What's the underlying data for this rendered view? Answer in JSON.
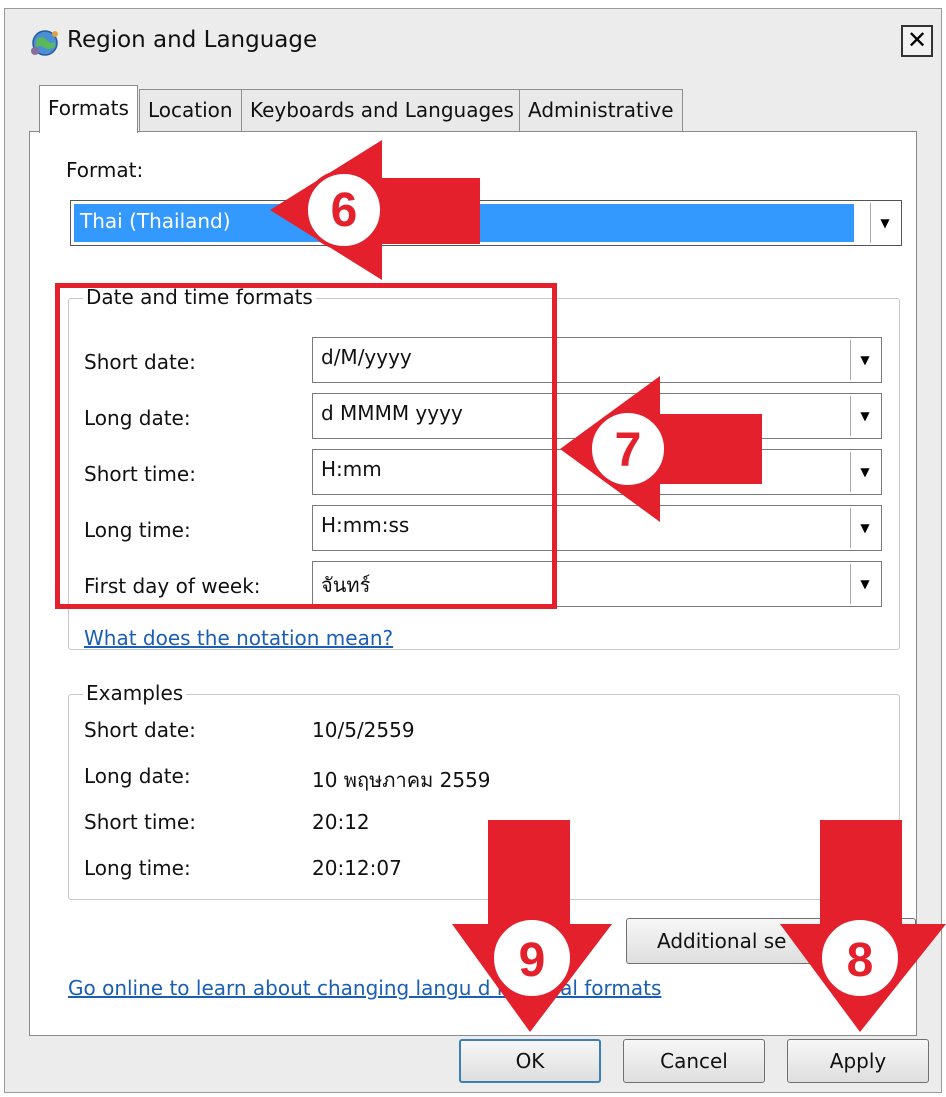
{
  "window": {
    "title": "Region and Language",
    "close_label": "✕"
  },
  "tabs": [
    {
      "label": "Formats",
      "active": true
    },
    {
      "label": "Location",
      "active": false
    },
    {
      "label": "Keyboards and Languages",
      "active": false
    },
    {
      "label": "Administrative",
      "active": false
    }
  ],
  "format": {
    "label": "Format:",
    "value": "Thai (Thailand)"
  },
  "date_time_formats": {
    "title": "Date and time formats",
    "rows": [
      {
        "label": "Short date:",
        "value": "d/M/yyyy"
      },
      {
        "label": "Long date:",
        "value": "d MMMM yyyy"
      },
      {
        "label": "Short time:",
        "value": "H:mm"
      },
      {
        "label": "Long time:",
        "value": "H:mm:ss"
      },
      {
        "label": "First day of week:",
        "value": "จันทร์"
      }
    ],
    "notation_link": "What does the notation mean?"
  },
  "examples": {
    "title": "Examples",
    "rows": [
      {
        "label": "Short date:",
        "value": "10/5/2559"
      },
      {
        "label": "Long date:",
        "value": "10 พฤษภาคม 2559"
      },
      {
        "label": "Short time:",
        "value": "20:12"
      },
      {
        "label": "Long time:",
        "value": "20:12:07"
      }
    ]
  },
  "additional_settings_label": "Additional se",
  "online_link": "Go online to learn about changing langu      d regional formats",
  "buttons": {
    "ok": "OK",
    "cancel": "Cancel",
    "apply": "Apply"
  },
  "annotations": {
    "color": "#e3202c",
    "step6": "6",
    "step7": "7",
    "step8": "8",
    "step9": "9"
  },
  "icons": {
    "title": "globe-users-icon",
    "dropdown": "chevron-down-icon"
  }
}
